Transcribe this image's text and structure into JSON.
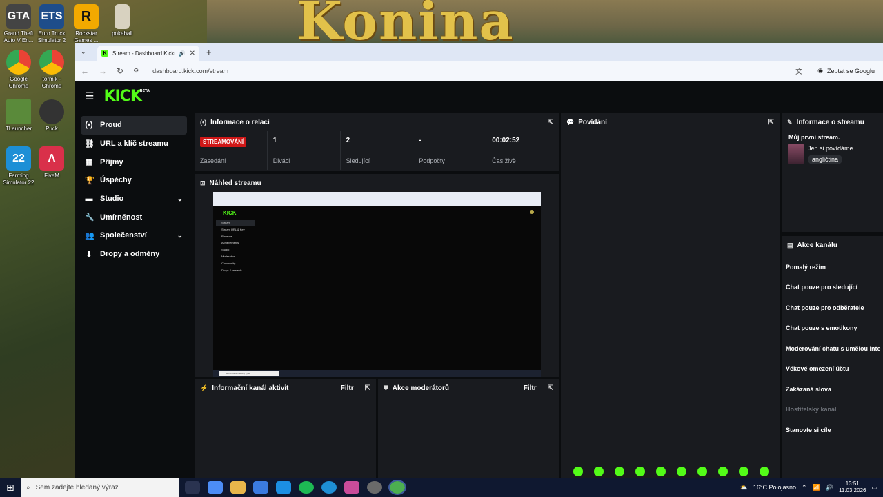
{
  "desktop": {
    "banner_text": "Konina",
    "icons": [
      {
        "label": "Grand Theft Auto V En...",
        "glyph": "GTA",
        "color": "#444"
      },
      {
        "label": "Euro Truck Simulator 2",
        "glyph": "ETS",
        "color": "#1e4d8a"
      },
      {
        "label": "Rockstar Games ...",
        "glyph": "R",
        "color": "#f2a900"
      },
      {
        "label": "pokeball",
        "glyph": "",
        "color": "#d8d2c0"
      },
      {
        "label": "Google Chrome",
        "glyph": "",
        "color": "#fff"
      },
      {
        "label": "tormik - Chrome",
        "glyph": "",
        "color": "#fff"
      },
      {
        "label": "TLauncher",
        "glyph": "",
        "color": "#5a8a3a"
      },
      {
        "label": "Puck",
        "glyph": "",
        "color": "#333"
      },
      {
        "label": "Farming Simulator 22",
        "glyph": "22",
        "color": "#1d8fd6"
      },
      {
        "label": "FiveM",
        "glyph": "Λ",
        "color": "#d9304a"
      }
    ]
  },
  "browser": {
    "tab_title": "Stream - Dashboard Kicku",
    "url": "dashboard.kick.com/stream",
    "ask_google": "Zeptat se Googlu"
  },
  "app": {
    "logo": "KICK",
    "logo_beta": "BETA",
    "sidebar": [
      {
        "label": "Proud",
        "icon": "(•)"
      },
      {
        "label": "URL a klíč streamu",
        "icon": "⛓"
      },
      {
        "label": "Příjmy",
        "icon": "▦"
      },
      {
        "label": "Úspěchy",
        "icon": "🏆"
      },
      {
        "label": "Studio",
        "icon": "▬"
      },
      {
        "label": "Umírněnost",
        "icon": "🔧"
      },
      {
        "label": "Společenství",
        "icon": "👥"
      },
      {
        "label": "Dropy a odměny",
        "icon": "⬇"
      }
    ],
    "session": {
      "title": "Informace o relaci",
      "badge": "STREAMOVÁNÍ",
      "cells": [
        {
          "value": "",
          "label": "Zasedání"
        },
        {
          "value": "1",
          "label": "Diváci"
        },
        {
          "value": "2",
          "label": "Sledující"
        },
        {
          "value": "-",
          "label": "Podpočty"
        },
        {
          "value": "00:02:52",
          "label": "Čas živě"
        }
      ]
    },
    "preview": {
      "title": "Náhled streamu",
      "mini_nav": [
        "Stream",
        "Stream URL & Key",
        "Revenue",
        "Achievements",
        "Studio",
        "Moderation",
        "Community",
        "Drops & rewards"
      ],
      "mini_search": "Sem zadejte hledaný výraz"
    },
    "activity": {
      "title": "Informační kanál aktivit",
      "filter": "Filtr"
    },
    "mod_actions": {
      "title": "Akce moderátorů",
      "filter": "Filtr"
    },
    "chat": {
      "title": "Povídání"
    },
    "stream_info": {
      "title": "Informace o streamu",
      "stream_title": "Můj první stream.",
      "category": "Jen si povídáme",
      "language": "angličtina"
    },
    "channel_actions": {
      "title": "Akce kanálu",
      "items": [
        {
          "label": "Pomalý režim",
          "disabled": false
        },
        {
          "label": "Chat pouze pro sledující",
          "disabled": false
        },
        {
          "label": "Chat pouze pro odběratele",
          "disabled": false
        },
        {
          "label": "Chat pouze s emotikony",
          "disabled": false
        },
        {
          "label": "Moderování chatu s umělou inte",
          "disabled": false
        },
        {
          "label": "Věkové omezení účtu",
          "disabled": false
        },
        {
          "label": "Zakázaná slova",
          "disabled": false
        },
        {
          "label": "Hostitelský kanál",
          "disabled": true
        },
        {
          "label": "Stanovte si cíle",
          "disabled": false
        }
      ]
    }
  },
  "taskbar": {
    "search_placeholder": "Sem zadejte hledaný výraz",
    "weather": "16°C Polojasno",
    "time": "13:51",
    "date": "11.03.2026",
    "apps": [
      "#4c8df6",
      "#e8b64b",
      "#3b7be0",
      "#1c8fe3",
      "#1db954",
      "#1e8fd6",
      "#c94c9a",
      "#6a6a6a",
      "#4caf50"
    ]
  },
  "colors": {
    "kick_green": "#53fc18",
    "live_red": "#d01717",
    "panel": "#191b1f",
    "bg": "#0b0d0f"
  }
}
